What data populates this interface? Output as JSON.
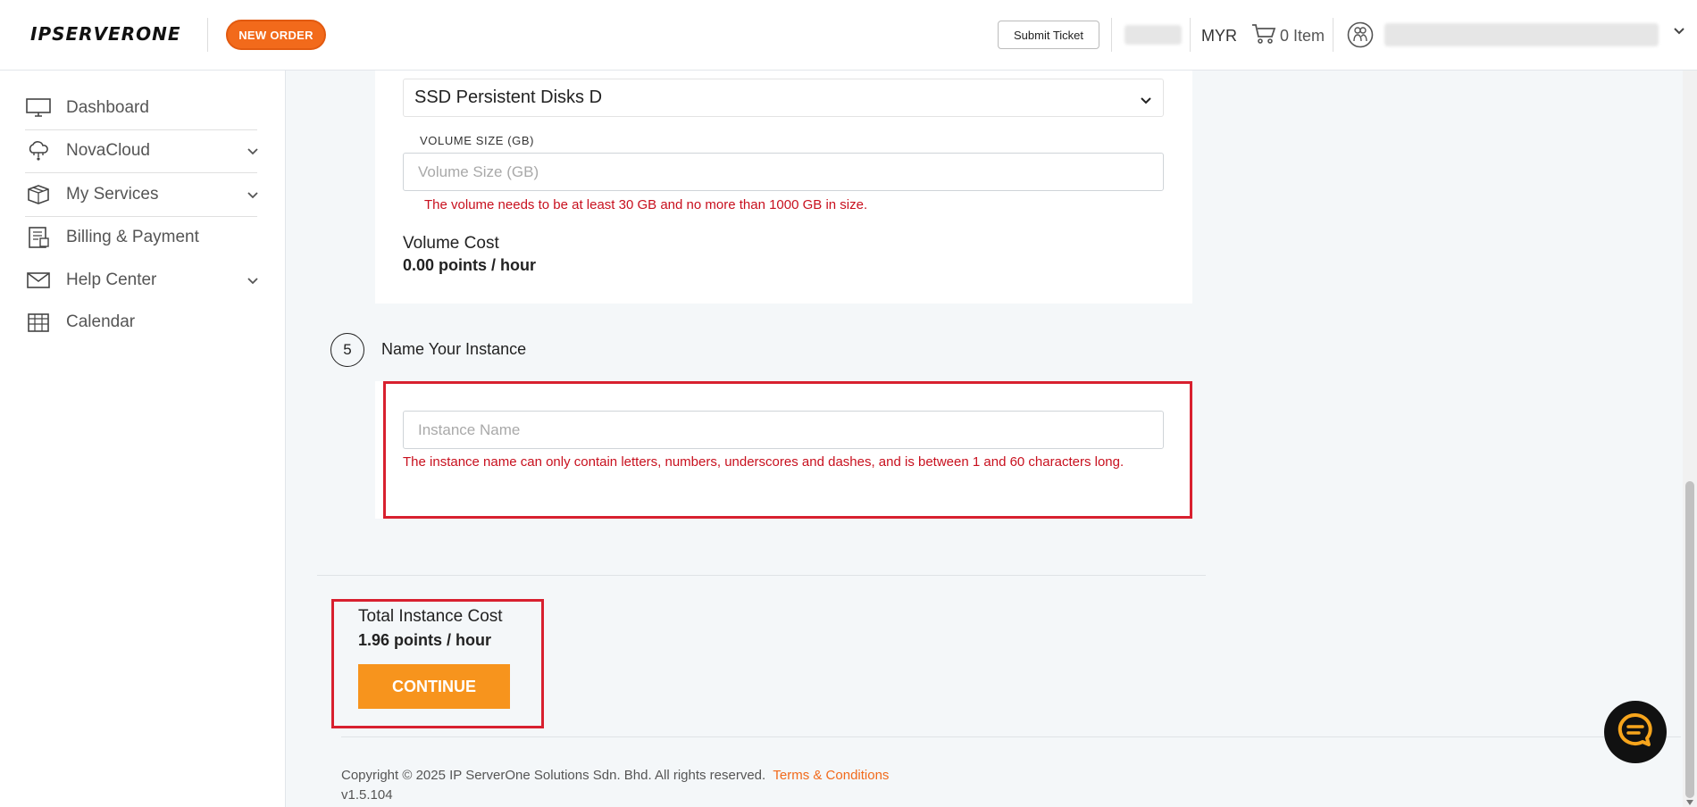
{
  "header": {
    "logo_text": "IPSERVERONE",
    "new_order_label": "NEW ORDER",
    "submit_ticket_label": "Submit Ticket",
    "currency": "MYR",
    "cart_label": "0 Item"
  },
  "sidebar": {
    "items": [
      {
        "label": "Dashboard"
      },
      {
        "label": "NovaCloud"
      },
      {
        "label": "My Services"
      },
      {
        "label": "Billing & Payment"
      },
      {
        "label": "Help Center"
      },
      {
        "label": "Calendar"
      }
    ]
  },
  "volume": {
    "disk_type_selected": "SSD Persistent Disks D",
    "size_label": "VOLUME SIZE (GB)",
    "size_placeholder": "Volume Size (GB)",
    "size_error": "The volume needs to be at least 30 GB and no more than 1000 GB in size.",
    "cost_label": "Volume Cost",
    "cost_value": "0.00 points / hour"
  },
  "step5": {
    "number": "5",
    "title": "Name Your Instance",
    "name_placeholder": "Instance Name",
    "name_error": "The instance name can only contain letters, numbers, underscores and dashes, and is between 1 and 60 characters long."
  },
  "summary": {
    "total_label": "Total Instance Cost",
    "total_value": "1.96 points / hour",
    "continue_label": "CONTINUE"
  },
  "footer": {
    "copyright": "Copyright © 2025 IP ServerOne Solutions Sdn. Bhd. All rights reserved.",
    "terms_label": "Terms & Conditions",
    "version": "v1.5.104"
  },
  "colors": {
    "accent": "#f7941d",
    "brand_orange": "#f26a1b",
    "error": "#c8101e",
    "highlight": "#d8202f"
  }
}
